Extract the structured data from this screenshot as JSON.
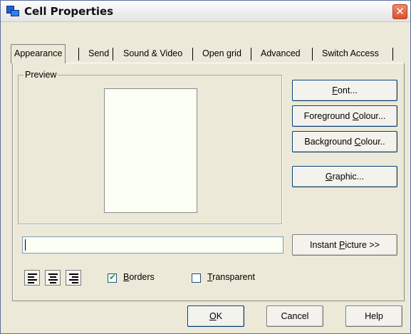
{
  "window": {
    "title": "Cell Properties",
    "close_glyph": "✕",
    "icon": "app-window-icon"
  },
  "tabs": [
    {
      "label": "Appearance",
      "selected": true
    },
    {
      "label": "Send",
      "selected": false
    },
    {
      "label": "Sound & Video",
      "selected": false
    },
    {
      "label": "Open grid",
      "selected": false
    },
    {
      "label": "Advanced",
      "selected": false
    },
    {
      "label": "Switch Access",
      "selected": false
    }
  ],
  "preview": {
    "legend": "Preview"
  },
  "buttons": {
    "font": {
      "pre": "",
      "key": "F",
      "post": "ont..."
    },
    "foreground": {
      "pre": "Foreground ",
      "key": "C",
      "post": "olour..."
    },
    "background": {
      "pre": "Background ",
      "key": "C",
      "post": "olour.."
    },
    "graphic": {
      "pre": "",
      "key": "G",
      "post": "raphic..."
    },
    "instant_picture": {
      "pre": "Instant ",
      "key": "P",
      "post": "icture >>"
    }
  },
  "text_field": {
    "value": ""
  },
  "alignment": {
    "options": [
      "align-left-icon",
      "align-center-icon",
      "align-right-icon"
    ]
  },
  "checkboxes": {
    "borders": {
      "key": "B",
      "post": "orders",
      "checked": true
    },
    "transparent": {
      "key": "T",
      "post": "ransparent",
      "checked": false
    }
  },
  "footer": {
    "ok": {
      "pre": "",
      "key": "O",
      "post": "K"
    },
    "cancel": "Cancel",
    "help": "Help"
  },
  "colors": {
    "panel": "#ece9d8",
    "preview_fill": "#fbfff4",
    "button_border": "#003c74"
  }
}
